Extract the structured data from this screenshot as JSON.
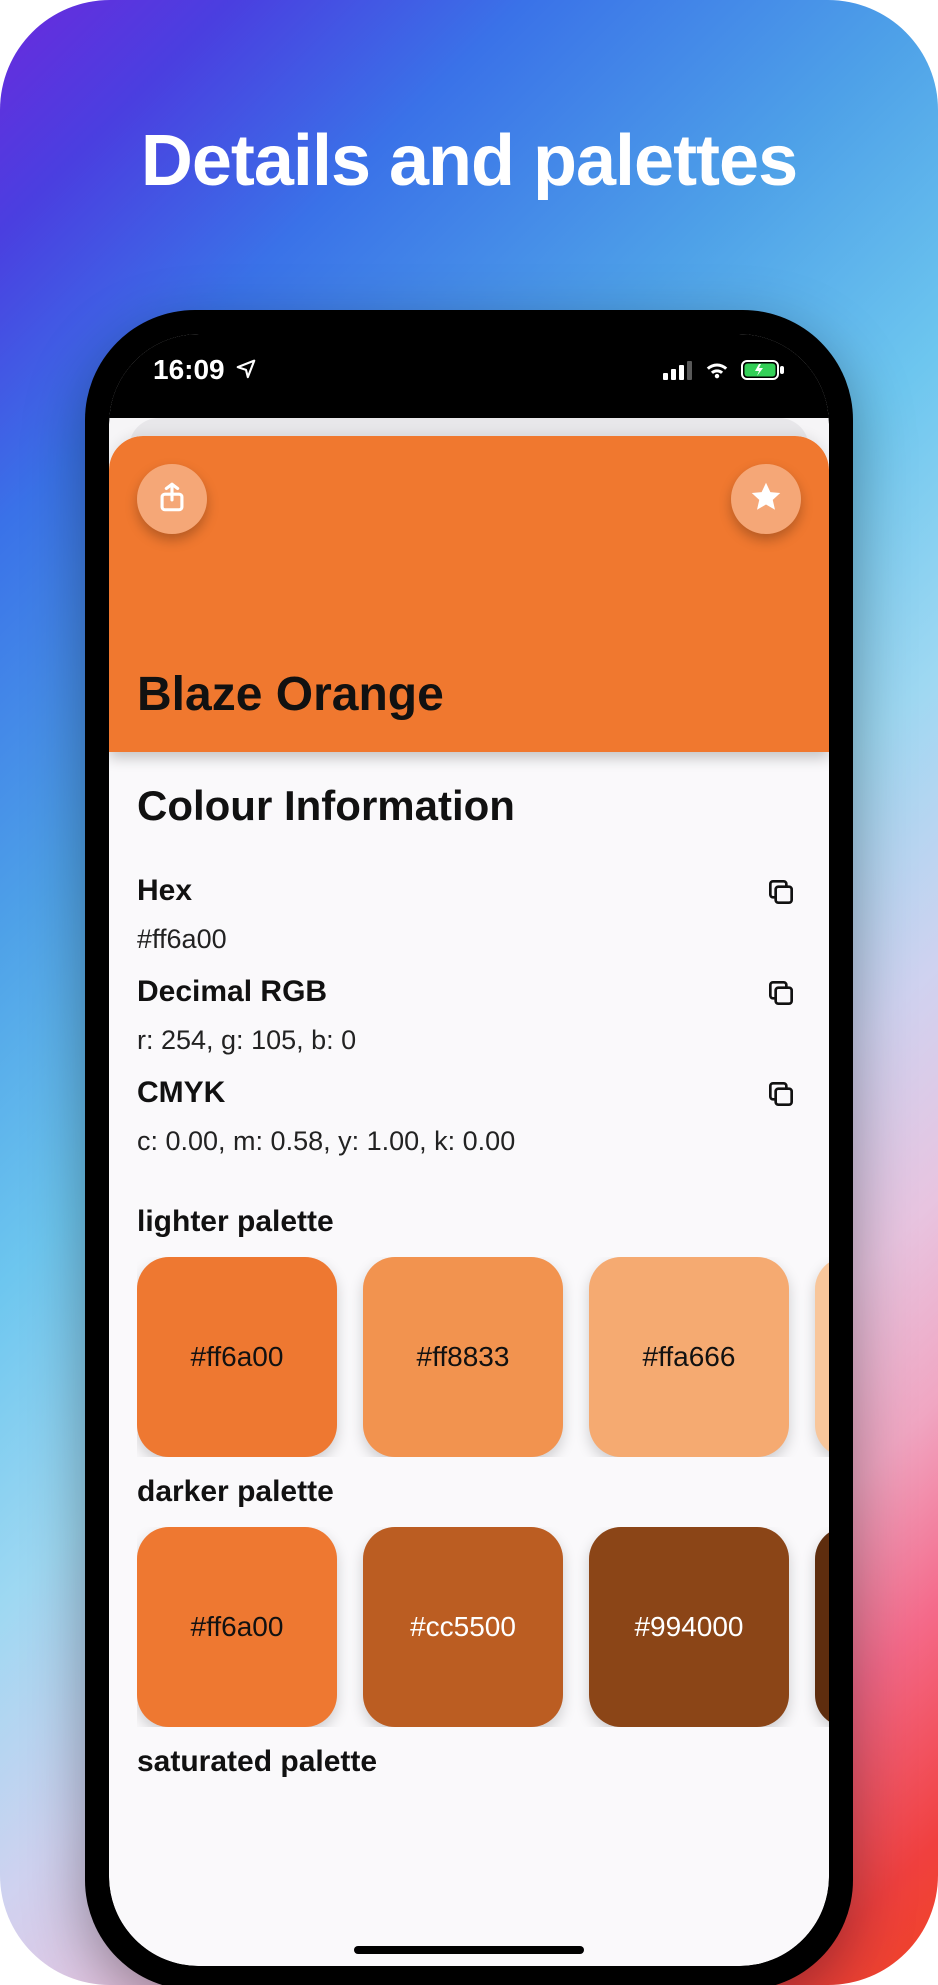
{
  "headline": "Details and palettes",
  "status": {
    "time": "16:09"
  },
  "header": {
    "bg": "#f0782f",
    "title": "Blaze Orange"
  },
  "info": {
    "section_title": "Colour Information",
    "rows": [
      {
        "label": "Hex",
        "value": "#ff6a00"
      },
      {
        "label": "Decimal RGB",
        "value": "r: 254, g: 105, b: 0"
      },
      {
        "label": "CMYK",
        "value": "c: 0.00, m: 0.58, y: 1.00, k:  0.00"
      }
    ]
  },
  "palettes": [
    {
      "label": "lighter palette",
      "swatches": [
        {
          "hex": "#ff6a00",
          "bg": "#ee7831"
        },
        {
          "hex": "#ff8833",
          "bg": "#f2934f"
        },
        {
          "hex": "#ffa666",
          "bg": "#f5aa71"
        },
        {
          "hex": "#",
          "bg": "#f8c69b"
        }
      ]
    },
    {
      "label": "darker palette",
      "swatches": [
        {
          "hex": "#ff6a00",
          "bg": "#ee7831"
        },
        {
          "hex": "#cc5500",
          "bg": "#bb5d22"
        },
        {
          "hex": "#994000",
          "bg": "#8b4517"
        },
        {
          "hex": "#",
          "bg": "#5e2d0e"
        }
      ]
    },
    {
      "label": "saturated palette",
      "swatches": []
    }
  ]
}
